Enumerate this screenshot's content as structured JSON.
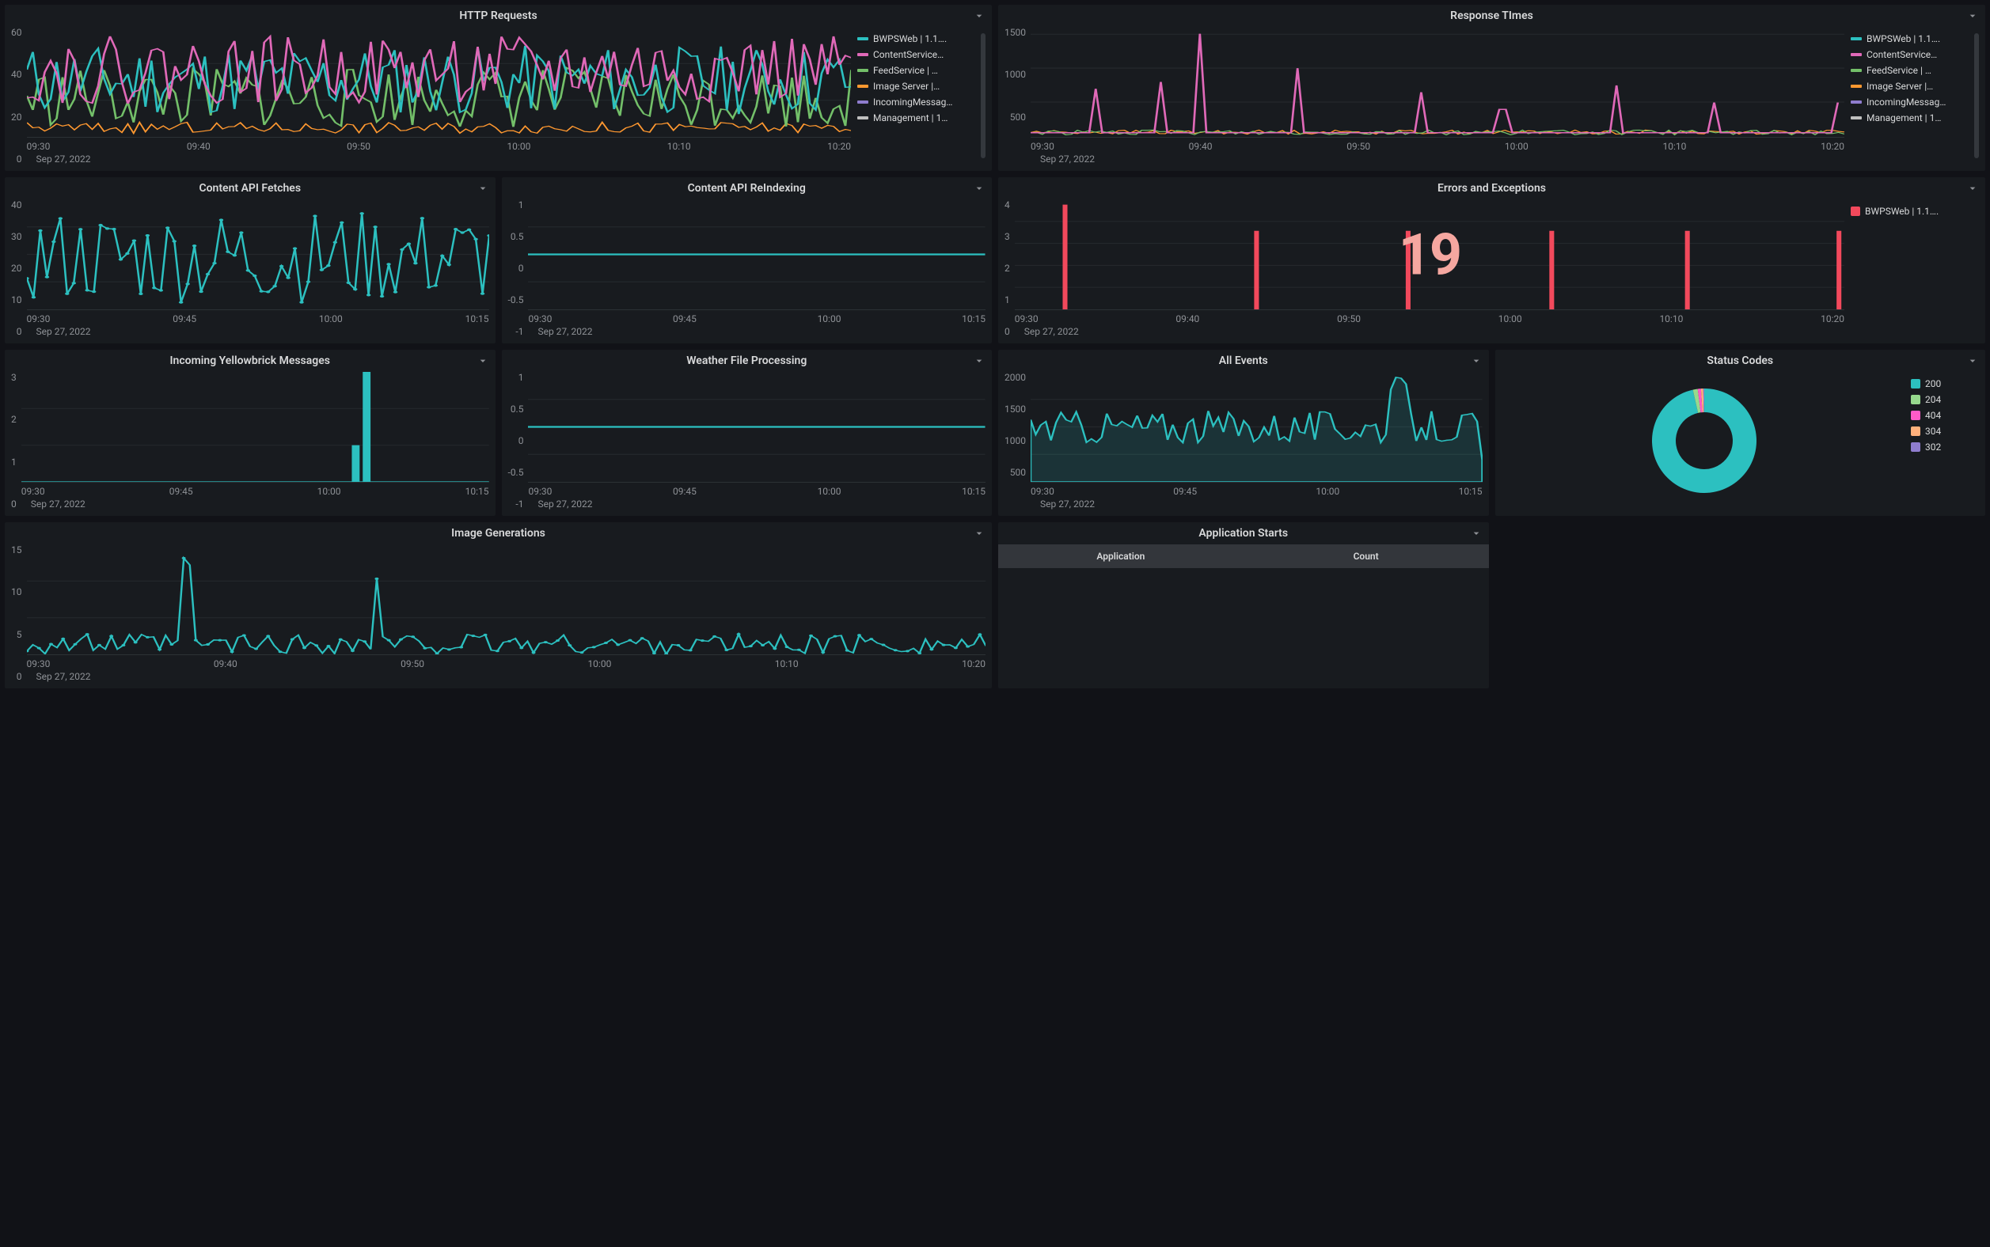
{
  "date_label": "Sep 27, 2022",
  "colors": {
    "teal": "#2cc0c0",
    "pink": "#e069b8",
    "green": "#73bf69",
    "orange": "#ff9830",
    "purple": "#8f7dce",
    "gray": "#bfbfbf",
    "red": "#f2495c",
    "salmon": "#f5a7a0",
    "lime": "#96d98d",
    "magenta": "#ff5bc8",
    "peach": "#ffb07c"
  },
  "panels": {
    "http": {
      "title": "HTTP Requests"
    },
    "resp": {
      "title": "Response TImes"
    },
    "cfetch": {
      "title": "Content API Fetches"
    },
    "creidx": {
      "title": "Content API ReIndexing"
    },
    "errors": {
      "title": "Errors and Exceptions"
    },
    "yellow": {
      "title": "Incoming Yellowbrick Messages"
    },
    "weather": {
      "title": "Weather File Processing"
    },
    "events": {
      "title": "All Events"
    },
    "status": {
      "title": "Status Codes"
    },
    "imgen": {
      "title": "Image Generations"
    },
    "appstart": {
      "title": "Application Starts"
    }
  },
  "legends": {
    "http": [
      {
        "label": "BWPSWeb | 1.1….",
        "color": "teal"
      },
      {
        "label": "ContentService…",
        "color": "pink"
      },
      {
        "label": "FeedService | …",
        "color": "green"
      },
      {
        "label": "Image Server |…",
        "color": "orange"
      },
      {
        "label": "IncomingMessag…",
        "color": "purple"
      },
      {
        "label": "Management | 1…",
        "color": "gray"
      }
    ],
    "resp": [
      {
        "label": "BWPSWeb | 1.1….",
        "color": "teal"
      },
      {
        "label": "ContentService…",
        "color": "pink"
      },
      {
        "label": "FeedService | …",
        "color": "green"
      },
      {
        "label": "Image Server |…",
        "color": "orange"
      },
      {
        "label": "IncomingMessag…",
        "color": "purple"
      },
      {
        "label": "Management | 1…",
        "color": "gray"
      }
    ],
    "errors": [
      {
        "label": "BWPSWeb | 1.1….",
        "color": "red"
      }
    ],
    "status": [
      {
        "label": "200",
        "color": "teal"
      },
      {
        "label": "204",
        "color": "lime"
      },
      {
        "label": "404",
        "color": "magenta"
      },
      {
        "label": "304",
        "color": "peach"
      },
      {
        "label": "302",
        "color": "purple"
      }
    ]
  },
  "appstart_table": {
    "headers": [
      "Application",
      "Count"
    ]
  },
  "chart_data": [
    {
      "id": "http",
      "type": "line",
      "title": "HTTP Requests",
      "x_ticks": [
        "09:30",
        "09:40",
        "09:50",
        "10:00",
        "10:10",
        "10:20"
      ],
      "y_ticks": [
        0,
        20,
        40,
        60
      ],
      "ylim": [
        0,
        60
      ],
      "series": [
        {
          "name": "BWPSWeb",
          "color": "teal",
          "approx_range": [
            12,
            50
          ],
          "mean": 28
        },
        {
          "name": "ContentService",
          "color": "pink",
          "approx_range": [
            18,
            55
          ],
          "mean": 32
        },
        {
          "name": "FeedService",
          "color": "green",
          "approx_range": [
            5,
            38
          ],
          "mean": 18
        },
        {
          "name": "Image Server",
          "color": "orange",
          "approx_range": [
            2,
            8
          ],
          "mean": 4
        },
        {
          "name": "IncomingMessag",
          "color": "purple",
          "approx_range": [
            0,
            5
          ],
          "mean": 1
        },
        {
          "name": "Management",
          "color": "gray",
          "approx_range": [
            0,
            3
          ],
          "mean": 1
        }
      ]
    },
    {
      "id": "resp",
      "type": "line",
      "title": "Response TImes",
      "x_ticks": [
        "09:30",
        "09:40",
        "09:50",
        "10:00",
        "10:10",
        "10:20"
      ],
      "y_ticks": [
        500,
        1000,
        1500
      ],
      "ylim": [
        0,
        1600
      ],
      "series": [
        {
          "name": "ContentService",
          "color": "pink",
          "spikes_at": [
            "09:30",
            "09:35",
            "09:37",
            "09:43",
            "09:50",
            "09:55",
            "10:03",
            "10:09",
            "10:20"
          ],
          "spike_heights": [
            700,
            800,
            1500,
            1000,
            650,
            400,
            750,
            500,
            500
          ],
          "baseline": 60
        },
        {
          "name": "BWPSWeb",
          "color": "teal",
          "baseline": 50
        },
        {
          "name": "FeedService",
          "color": "green",
          "baseline": 60
        },
        {
          "name": "Image Server",
          "color": "orange",
          "baseline": 80
        },
        {
          "name": "IncomingMessag",
          "color": "purple",
          "baseline": 20
        },
        {
          "name": "Management",
          "color": "gray",
          "baseline": 20
        }
      ]
    },
    {
      "id": "cfetch",
      "type": "line",
      "title": "Content API Fetches",
      "x_ticks": [
        "09:30",
        "09:45",
        "10:00",
        "10:15"
      ],
      "y_ticks": [
        0,
        10,
        20,
        30,
        40
      ],
      "ylim": [
        0,
        42
      ],
      "series": [
        {
          "name": "fetches",
          "color": "teal",
          "approx_range": [
            2,
            37
          ],
          "mean": 15
        }
      ]
    },
    {
      "id": "creidx",
      "type": "line",
      "title": "Content API ReIndexing",
      "x_ticks": [
        "09:30",
        "09:45",
        "10:00",
        "10:15"
      ],
      "y_ticks": [
        -1,
        -0.5,
        0,
        0.5,
        1
      ],
      "ylim": [
        -1,
        1
      ],
      "series": [
        {
          "name": "reindex",
          "color": "teal",
          "values_constant": 0
        }
      ]
    },
    {
      "id": "errors",
      "type": "bar",
      "title": "Errors and Exceptions",
      "x_ticks": [
        "09:30",
        "09:40",
        "09:50",
        "10:00",
        "10:10",
        "10:20"
      ],
      "y_ticks": [
        0,
        1,
        2,
        3,
        4
      ],
      "ylim": [
        0,
        4.2
      ],
      "big_value": 19,
      "series": [
        {
          "name": "BWPSWeb",
          "color": "red",
          "points": [
            {
              "x": "09:30",
              "v": 4
            },
            {
              "x": "09:42",
              "v": 3
            },
            {
              "x": "09:51",
              "v": 3
            },
            {
              "x": "10:00",
              "v": 3
            },
            {
              "x": "10:09",
              "v": 3
            },
            {
              "x": "10:20",
              "v": 3
            }
          ]
        }
      ]
    },
    {
      "id": "yellow",
      "type": "bar",
      "title": "Incoming Yellowbrick Messages",
      "x_ticks": [
        "09:30",
        "09:45",
        "10:00",
        "10:15"
      ],
      "y_ticks": [
        0,
        1,
        2,
        3
      ],
      "ylim": [
        0,
        3.2
      ],
      "series": [
        {
          "name": "msgs",
          "color": "teal",
          "points": [
            {
              "x": "10:07",
              "v": 1
            },
            {
              "x": "10:08",
              "v": 3
            }
          ]
        }
      ]
    },
    {
      "id": "weather",
      "type": "line",
      "title": "Weather File Processing",
      "x_ticks": [
        "09:30",
        "09:45",
        "10:00",
        "10:15"
      ],
      "y_ticks": [
        -1,
        -0.5,
        0,
        0.5,
        1
      ],
      "ylim": [
        -1,
        1
      ],
      "series": [
        {
          "name": "weather",
          "color": "teal",
          "values_constant": 0
        }
      ]
    },
    {
      "id": "events",
      "type": "area",
      "title": "All Events",
      "x_ticks": [
        "09:30",
        "09:45",
        "10:00",
        "10:15"
      ],
      "y_ticks": [
        500,
        1000,
        1500,
        2000
      ],
      "ylim": [
        0,
        2000
      ],
      "series": [
        {
          "name": "events",
          "color": "teal",
          "approx_range": [
            400,
            1750
          ],
          "mean": 950
        }
      ]
    },
    {
      "id": "status",
      "type": "pie",
      "title": "Status Codes",
      "slices": [
        {
          "label": "200",
          "color": "teal",
          "pct": 96.5
        },
        {
          "label": "204",
          "color": "lime",
          "pct": 1.5
        },
        {
          "label": "404",
          "color": "magenta",
          "pct": 1.0
        },
        {
          "label": "304",
          "color": "peach",
          "pct": 0.7
        },
        {
          "label": "302",
          "color": "purple",
          "pct": 0.3
        }
      ]
    },
    {
      "id": "imgen",
      "type": "line",
      "title": "Image Generations",
      "x_ticks": [
        "09:30",
        "09:40",
        "09:50",
        "10:00",
        "10:10",
        "10:20"
      ],
      "y_ticks": [
        0,
        5,
        10,
        15
      ],
      "ylim": [
        0,
        16
      ],
      "series": [
        {
          "name": "imgen",
          "color": "teal",
          "baseline_range": [
            0,
            3
          ],
          "spikes": [
            {
              "x": "09:35",
              "v": 14
            },
            {
              "x": "09:36",
              "v": 13
            },
            {
              "x": "09:48",
              "v": 11
            }
          ]
        }
      ]
    },
    {
      "id": "appstart",
      "type": "table",
      "title": "Application Starts",
      "columns": [
        "Application",
        "Count"
      ],
      "rows": []
    }
  ]
}
